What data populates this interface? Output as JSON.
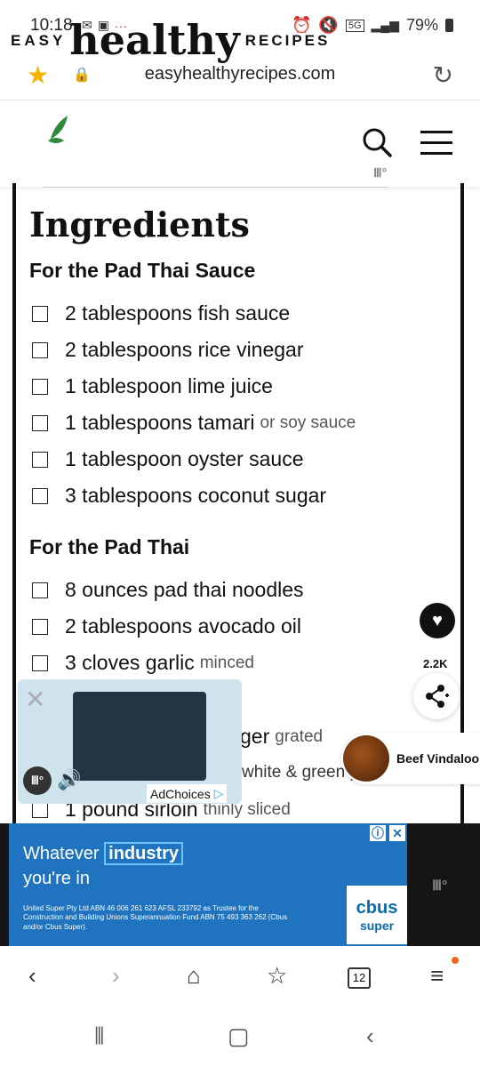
{
  "status_bar": {
    "time": "10:18",
    "battery": "79%",
    "signal": "5G"
  },
  "url_bar": {
    "url": "easyhealthyrecipes.com"
  },
  "site": {
    "logo_easy": "EASY",
    "logo_healthy": "healthy",
    "logo_recipes": "RECIPES"
  },
  "recipe": {
    "title": "Ingredients",
    "sections": [
      {
        "heading": "For the Pad Thai Sauce",
        "items": [
          {
            "text": "2 tablespoons fish sauce",
            "note": ""
          },
          {
            "text": "2 tablespoons rice vinegar",
            "note": ""
          },
          {
            "text": "1 tablespoon lime juice",
            "note": ""
          },
          {
            "text": "1 tablespoons tamari",
            "note": "or soy sauce"
          },
          {
            "text": "1 tablespoon oyster sauce",
            "note": ""
          },
          {
            "text": "3 tablespoons coconut sugar",
            "note": ""
          }
        ]
      },
      {
        "heading": "For the Pad Thai",
        "items": [
          {
            "text": "8 ounces pad thai noodles",
            "note": ""
          },
          {
            "text": "2 tablespoons avocado oil",
            "note": ""
          },
          {
            "text": "3 cloves garlic",
            "note": "minced"
          },
          {
            "text": "ger",
            "note": "grated"
          },
          {
            "text": "white & green p",
            "note": ""
          },
          {
            "text": "1 pound sirloin",
            "note": "thinly sliced"
          }
        ]
      }
    ]
  },
  "floating": {
    "share_count": "2.2K"
  },
  "video": {
    "adchoices": "AdChoices"
  },
  "related": {
    "title": "Beef Vindaloo"
  },
  "ad": {
    "headline_1": "Whatever",
    "headline_highlight": "industry",
    "headline_2": "you're in",
    "fine_print": "United Super Pty Ltd ABN 46 006 261 623 AFSL 233792 as Trustee for the Construction and Building Unions Superannuation Fund ABN 75 493 363 262 (Cbus and/or Cbus Super).",
    "logo_top": "cbus",
    "logo_bottom": "super"
  },
  "browser_nav": {
    "tab_count": "12"
  },
  "colors": {
    "accent_star": "#f2b400",
    "ad_blue": "#1f73bf",
    "notification_dot": "#ee6a1a"
  }
}
